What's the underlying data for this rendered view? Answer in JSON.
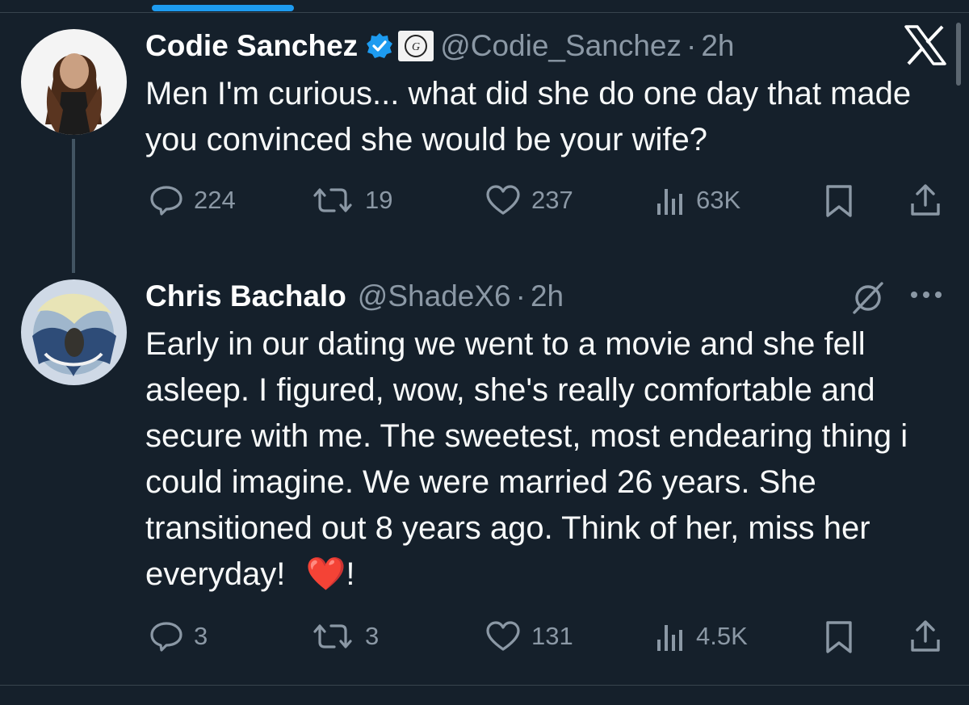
{
  "tweet1": {
    "name": "Codie Sanchez",
    "handle": "@Codie_Sanchez",
    "separator": "·",
    "time": "2h",
    "text": "Men I'm curious... what did she do one day that made you convinced she would be your wife?",
    "replies": "224",
    "retweets": "19",
    "likes": "237",
    "views": "63K",
    "verified_color": "#1d9bf0"
  },
  "tweet2": {
    "name": "Chris Bachalo",
    "handle": "@ShadeX6",
    "separator": "·",
    "time": "2h",
    "text": "Early in our dating we went to a movie and she fell asleep. I figured, wow, she's really comfortable and secure with me. The sweetest, most endearing thing i could imagine. We were married 26 years. She transitioned out 8 years ago. Think of her, miss her everyday!",
    "emoji": "❤️",
    "suffix": "!",
    "replies": "3",
    "retweets": "3",
    "likes": "131",
    "views": "4.5K"
  },
  "icons": {
    "reply": "reply-icon",
    "retweet": "retweet-icon",
    "like": "heart-icon",
    "views": "views-icon",
    "bookmark": "bookmark-icon",
    "share": "share-icon",
    "logo": "x-logo-icon",
    "grok": "grok-icon",
    "more": "more-icon"
  },
  "colors": {
    "background": "#15202b",
    "text": "#ffffff",
    "secondary": "#8b98a5",
    "accent": "#1d9bf0"
  }
}
